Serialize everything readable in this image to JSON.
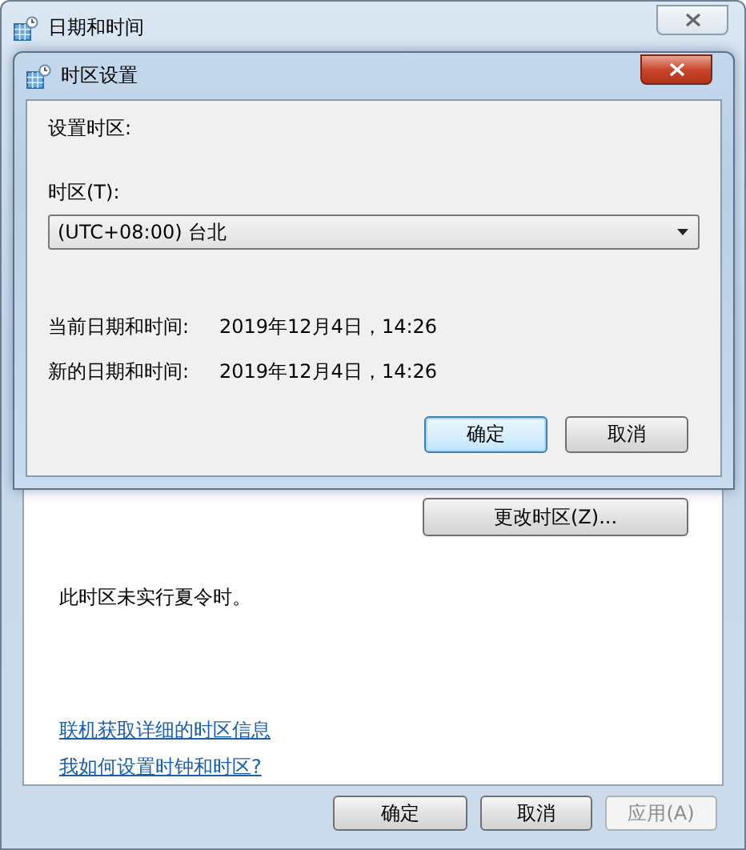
{
  "window": {
    "title": "日期和时间"
  },
  "dialog": {
    "title": "时区设置",
    "section_label": "设置时区:",
    "timezone_label": "时区(T):",
    "timezone_value": "(UTC+08:00) 台北",
    "rows": [
      {
        "label": "当前日期和时间:",
        "value": "2019年12月4日，14:26"
      },
      {
        "label": "新的日期和时间:",
        "value": "2019年12月4日，14:26"
      }
    ],
    "buttons": [
      {
        "label": "确定",
        "default": true
      },
      {
        "label": "取消",
        "default": false
      }
    ]
  },
  "change_button": "更改时区(Z)...",
  "dst_note": "此时区未实行夏令时。",
  "links": [
    "联机获取详细的时区信息",
    "我如何设置时钟和时区?"
  ],
  "buttons": [
    {
      "label": "确定",
      "disabled": false
    },
    {
      "label": "取消",
      "disabled": false
    },
    {
      "label": "应用(A)",
      "disabled": true
    }
  ]
}
